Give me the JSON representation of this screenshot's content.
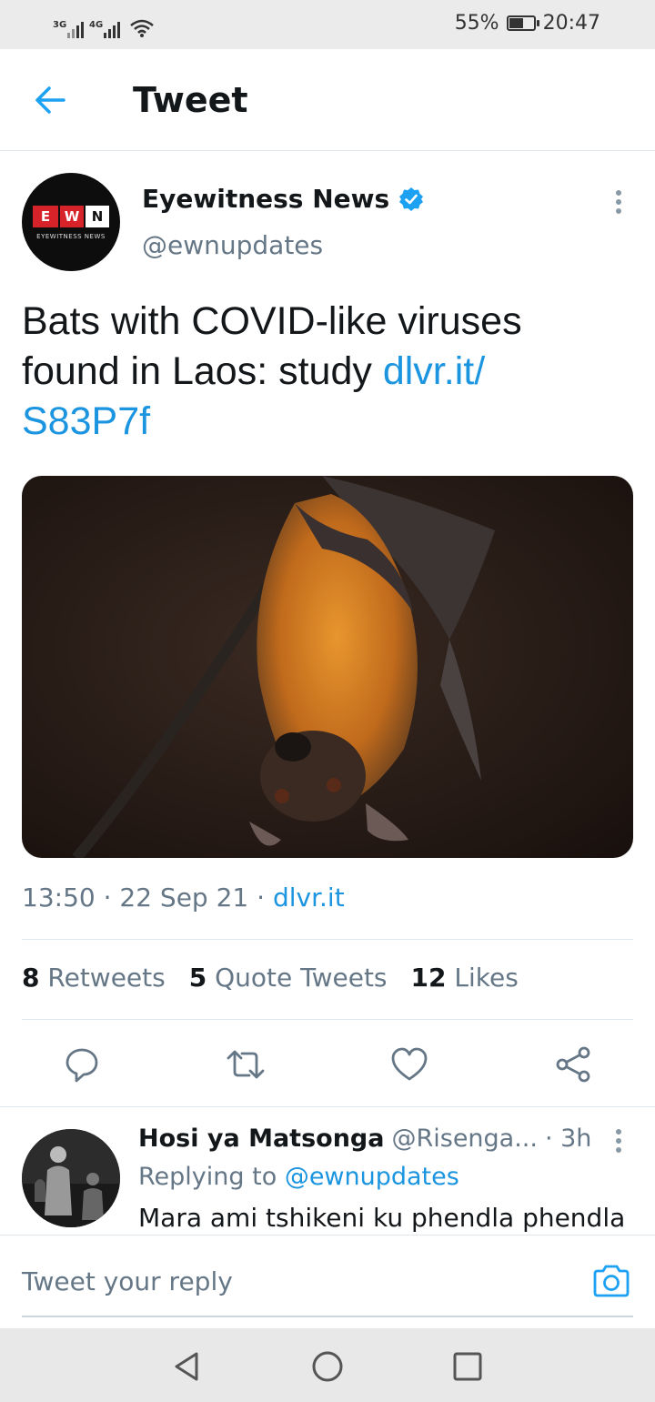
{
  "status_bar": {
    "signal1_label": "3G",
    "signal2_label": "4G",
    "battery_percent": "55%",
    "battery_level": 0.55,
    "time": "20:47"
  },
  "header": {
    "title": "Tweet",
    "back_icon": "arrow-left-icon"
  },
  "tweet": {
    "author": {
      "name": "Eyewitness News",
      "handle": "@ewnupdates",
      "verified": true,
      "avatar_logo": {
        "e": "E",
        "w": "W",
        "n": "N",
        "subtitle": "EYEWITNESS NEWS"
      }
    },
    "text_plain": "Bats with COVID-like viruses found in Laos: study ",
    "text_link": "dlvr.it/ S83P7f",
    "image_desc": "fruit-bat-photo",
    "time": "13:50",
    "date": "22 Sep 21",
    "source": "dlvr.it",
    "retweets_count": "8",
    "retweets_label": "Retweets",
    "quotes_count": "5",
    "quotes_label": "Quote Tweets",
    "likes_count": "12",
    "likes_label": "Likes"
  },
  "actions": [
    "reply-icon",
    "retweet-icon",
    "like-icon",
    "share-icon"
  ],
  "reply": {
    "name": "Hosi ya Matsonga",
    "handle": "@Risenga...",
    "time": "· 3h",
    "replying_label": "Replying to",
    "replying_to": "@ewnupdates",
    "text": "Mara ami tshikeni ku phendla phendla"
  },
  "composer": {
    "placeholder": "Tweet your reply",
    "camera_icon": "camera-icon"
  },
  "nav": [
    "back-triangle-icon",
    "home-circle-icon",
    "recents-square-icon"
  ],
  "colors": {
    "link": "#1b95e0",
    "secondary_text": "#657786",
    "primary_text": "#14171a",
    "ewn_red": "#d6232a"
  }
}
